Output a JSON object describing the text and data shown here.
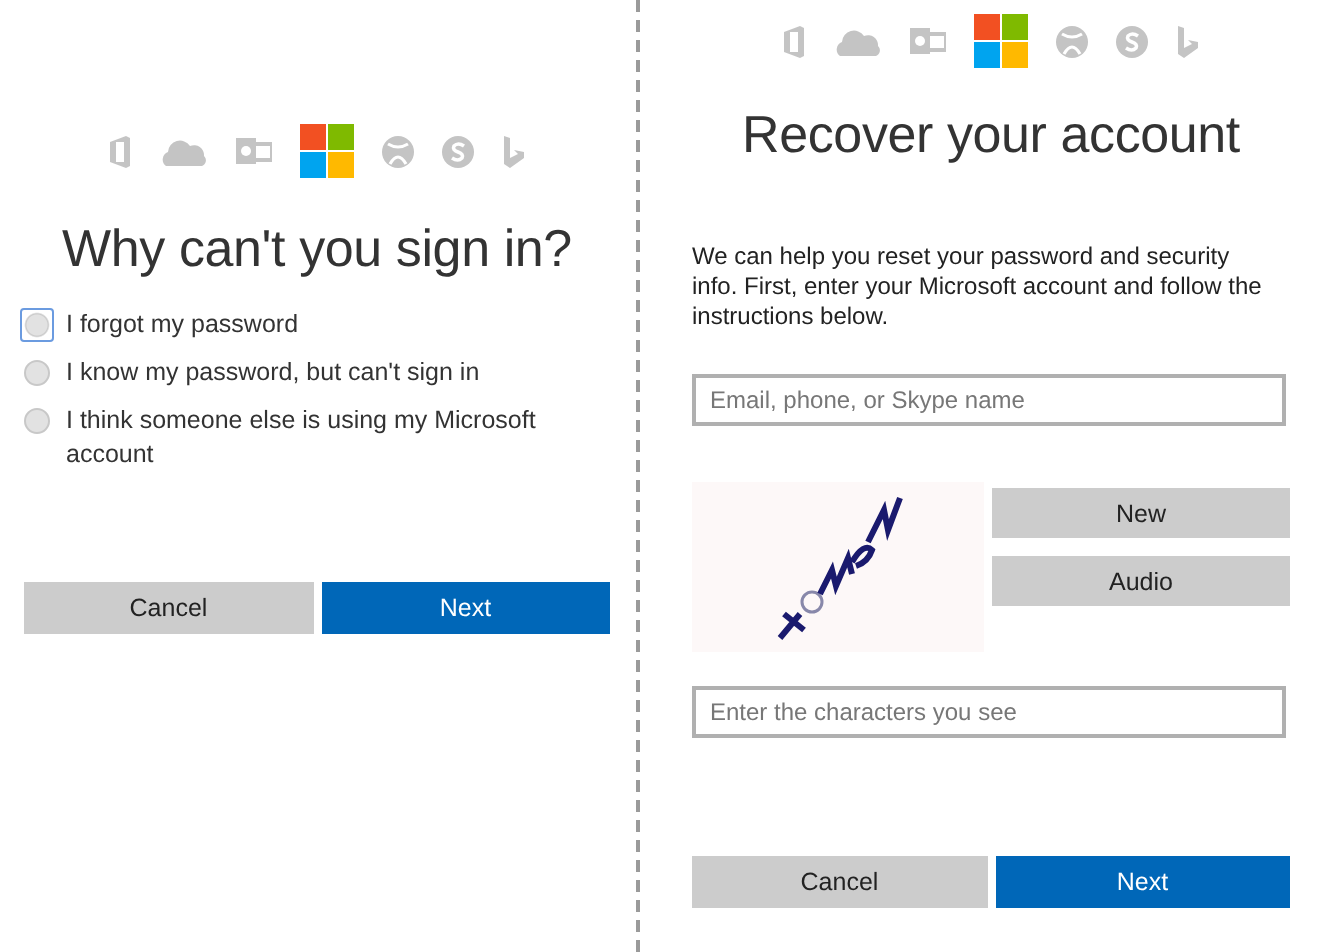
{
  "panels": [
    {
      "kind": "reasons",
      "title": "Why can't you sign in?",
      "options": [
        {
          "label": "I forgot my password",
          "selected": false,
          "focused": true
        },
        {
          "label": "I know my password, but can't sign in",
          "selected": false,
          "focused": false
        },
        {
          "label": "I think someone else is using my Microsoft account",
          "selected": false,
          "focused": false
        }
      ],
      "buttons": [
        {
          "label": "Cancel",
          "primary": false
        },
        {
          "label": "Next",
          "primary": true
        }
      ]
    },
    {
      "kind": "recover",
      "title": "Recover your account",
      "intro": "We can help you reset your password and security info. First, enter your Microsoft account and follow the instructions below.",
      "account_field": {
        "placeholder": "Email, phone, or Skype name"
      },
      "captcha": {
        "kind": "picture",
        "buttons": [
          "New",
          "Audio"
        ]
      },
      "captcha_field": {
        "placeholder": "Enter the characters you see"
      },
      "buttons": [
        {
          "label": "Cancel",
          "primary": false
        },
        {
          "label": "Next",
          "primary": true
        }
      ]
    }
  ]
}
